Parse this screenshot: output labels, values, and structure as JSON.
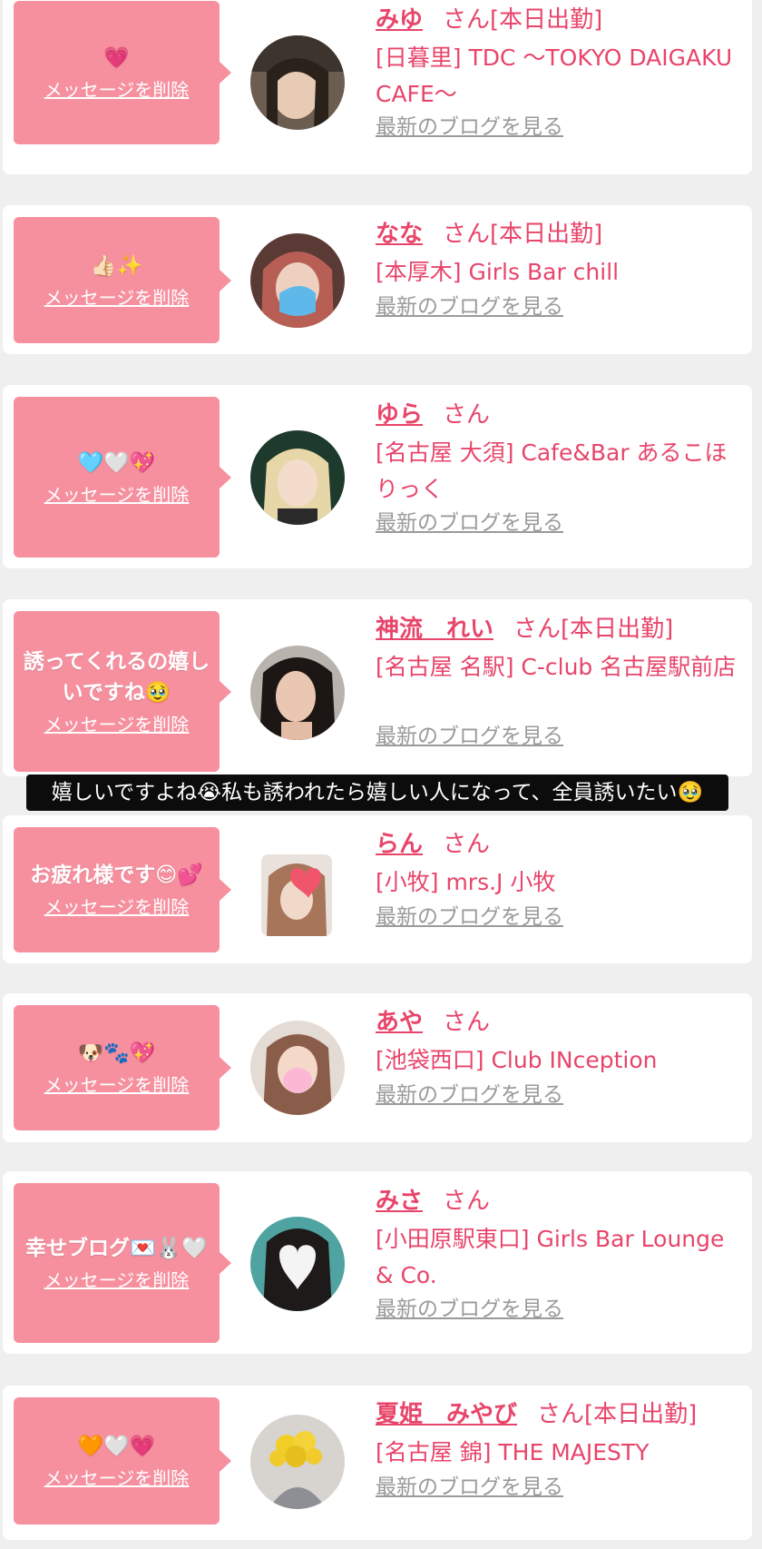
{
  "entries": [
    {
      "message": "💗",
      "delete_label": "メッセージを削除",
      "name": "みゆ",
      "honorific": "さん",
      "status": "[本日出勤]",
      "shop": "[日暮里] TDC 〜TOKYO DAIGAKU CAFE〜",
      "blog_label": "最新のブログを見る"
    },
    {
      "message": "👍🏻✨",
      "delete_label": "メッセージを削除",
      "name": "なな",
      "honorific": "さん",
      "status": "[本日出勤]",
      "shop": "[本厚木] Girls Bar chill",
      "blog_label": "最新のブログを見る"
    },
    {
      "message": "🩵🤍💖",
      "delete_label": "メッセージを削除",
      "name": "ゆら",
      "honorific": "さん",
      "status": "",
      "shop": "[名古屋 大須] Cafe&Bar あるこほりっく",
      "blog_label": "最新のブログを見る"
    },
    {
      "message": "誘ってくれるの嬉しいですね🥹",
      "delete_label": "メッセージを削除",
      "name": "神流　れい",
      "honorific": "さん",
      "status": "[本日出勤]",
      "shop": "[名古屋 名駅] C-club 名古屋駅前店",
      "blog_label": "最新のブログを見る"
    },
    {
      "message": "お疲れ様です😊💕",
      "delete_label": "メッセージを削除",
      "name": "らん",
      "honorific": "さん",
      "status": "",
      "shop": "[小牧] mrs.J 小牧",
      "blog_label": "最新のブログを見る"
    },
    {
      "message": "🐶🐾💖",
      "delete_label": "メッセージを削除",
      "name": "あや",
      "honorific": "さん",
      "status": "",
      "shop": "[池袋西口] Club INception",
      "blog_label": "最新のブログを見る"
    },
    {
      "message": "幸せブログ💌🐰🤍",
      "delete_label": "メッセージを削除",
      "name": "みさ",
      "honorific": "さん",
      "status": "",
      "shop": "[小田原駅東口] Girls Bar Lounge & Co.",
      "blog_label": "最新のブログを見る"
    },
    {
      "message": "🧡🤍💗",
      "delete_label": "メッセージを削除",
      "name": "夏姫　みやび",
      "honorific": "さん",
      "status": "[本日出勤]",
      "shop": "[名古屋 錦] THE MAJESTY",
      "blog_label": "最新のブログを見る"
    }
  ],
  "caption": "嬉しいですよね😭私も誘われたら嬉しい人になって、全員誘いたい🥹",
  "colors": {
    "accent": "#e8456a",
    "bubble": "#f6909f",
    "background": "#efefef",
    "link_gray": "#9a9a9a"
  }
}
